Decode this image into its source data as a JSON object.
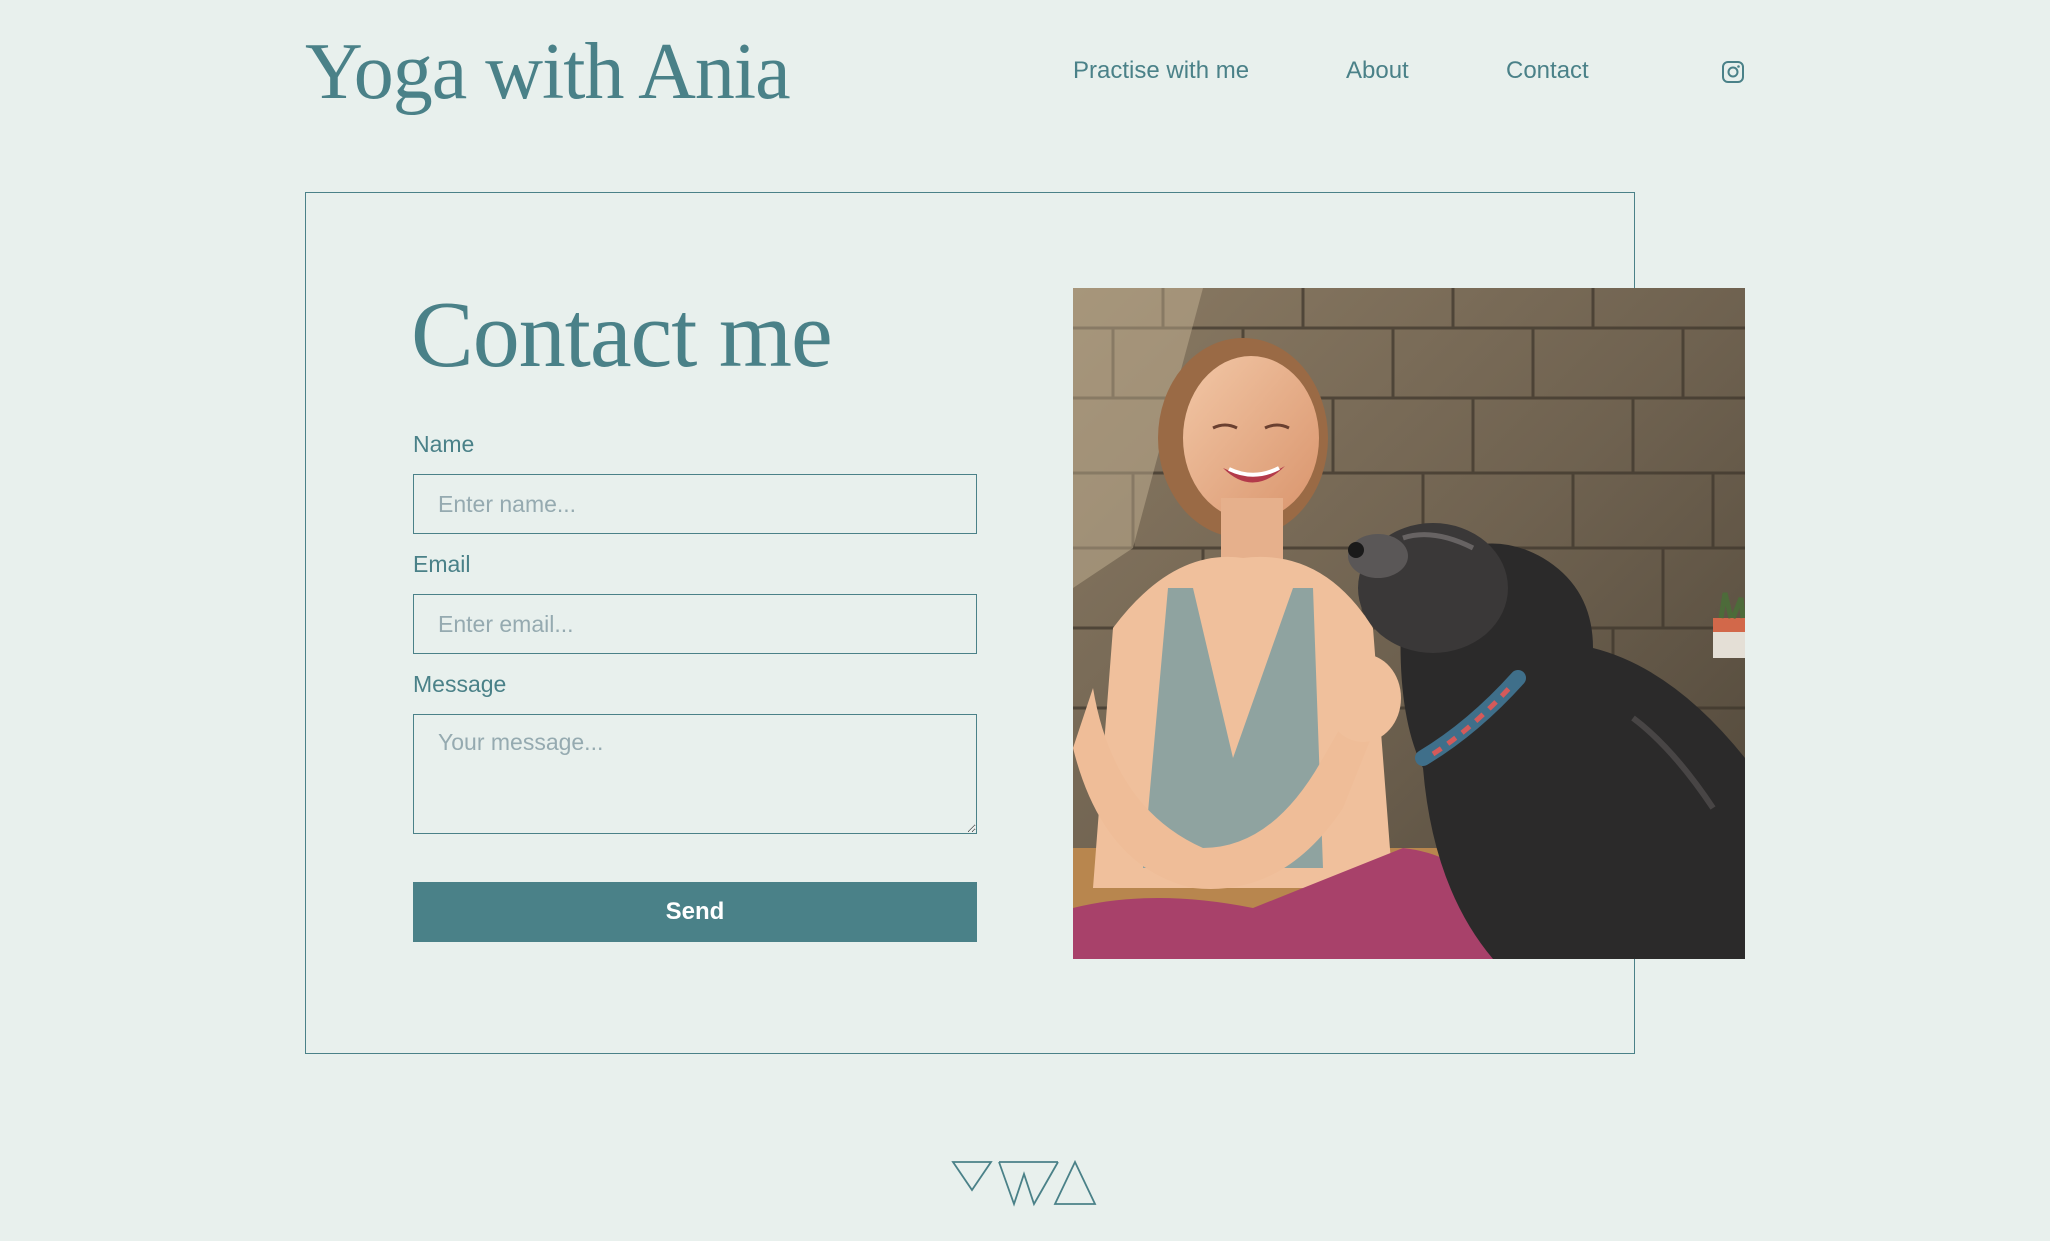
{
  "header": {
    "logo_text": "Yoga with Ania",
    "nav": [
      {
        "label": "Practise with me"
      },
      {
        "label": "About"
      },
      {
        "label": "Contact"
      }
    ],
    "social_icon": "instagram-icon"
  },
  "contact": {
    "title": "Contact me",
    "name_label": "Name",
    "name_placeholder": "Enter name...",
    "email_label": "Email",
    "email_placeholder": "Enter email...",
    "message_label": "Message",
    "message_placeholder": "Your message...",
    "send_label": "Send"
  },
  "photo": {
    "icon": "photo-woman-with-dog"
  },
  "footer": {
    "logo_icon": "yoga-with-ania-monogram-icon"
  },
  "colors": {
    "background": "#e8f0ed",
    "accent": "#4a8188",
    "placeholder": "#95aab0",
    "button_text": "#ffffff"
  }
}
